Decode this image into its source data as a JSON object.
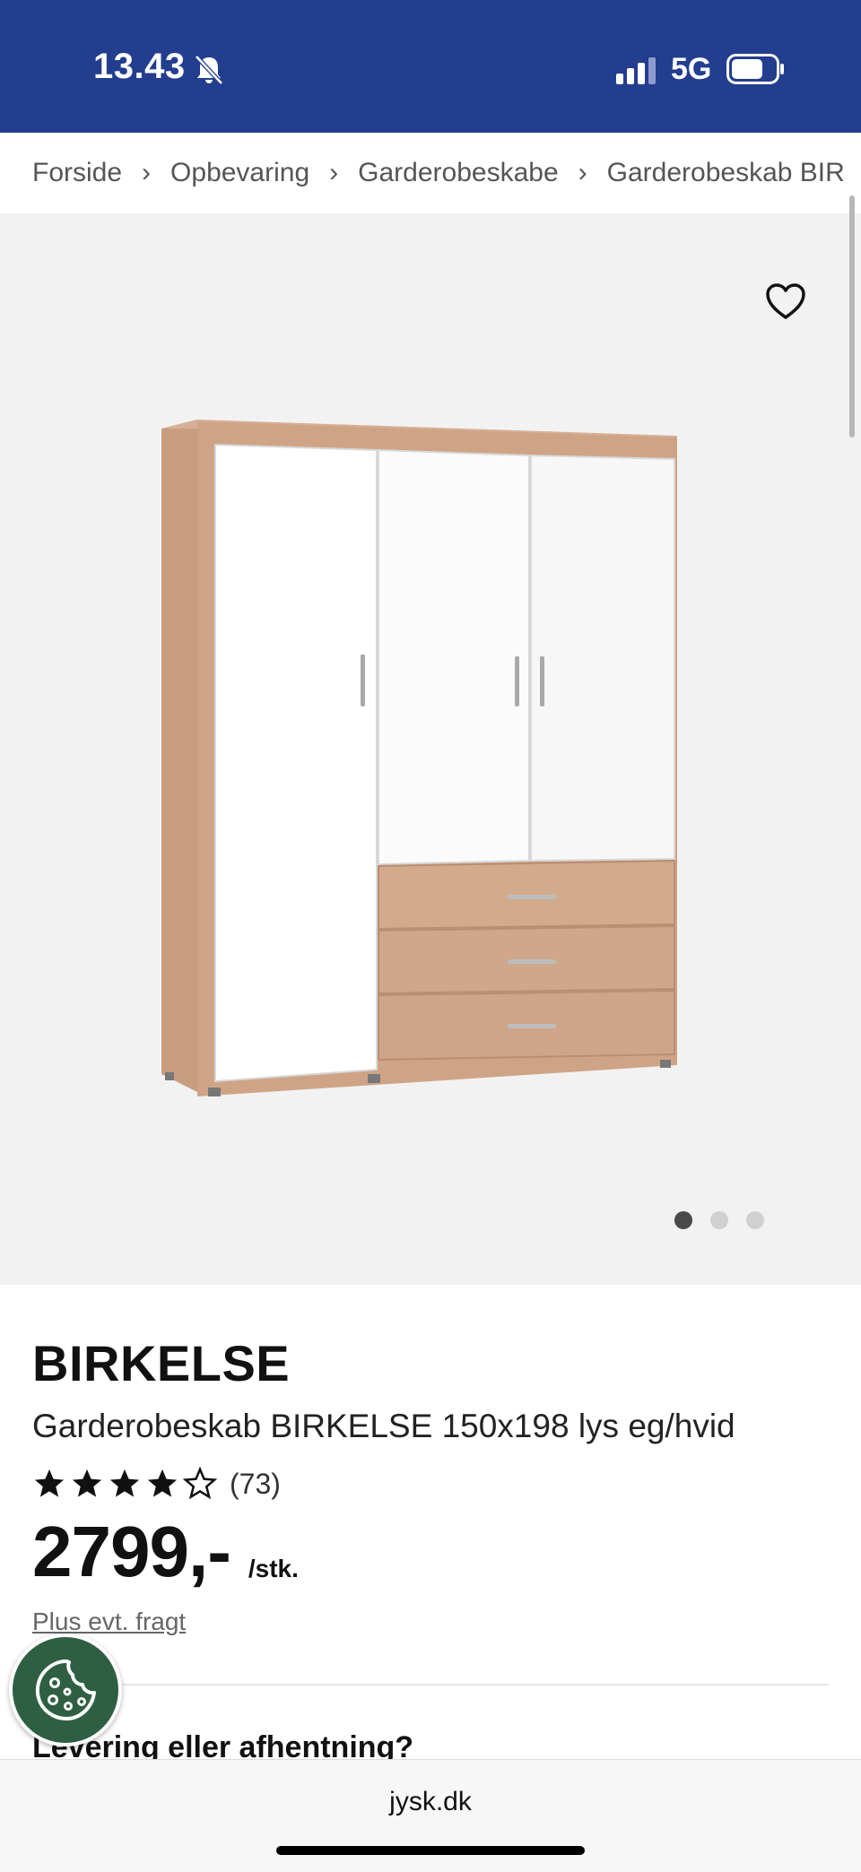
{
  "status_bar": {
    "time": "13.43",
    "network": "5G"
  },
  "breadcrumb": [
    {
      "label": "Forside"
    },
    {
      "label": "Opbevaring"
    },
    {
      "label": "Garderobeskabe"
    },
    {
      "label": "Garderobeskab BIR"
    }
  ],
  "gallery": {
    "slide_count": 3,
    "active_slide": 1
  },
  "product": {
    "brand": "BIRKELSE",
    "title": "Garderobeskab BIRKELSE 150x198 lys eg/hvid",
    "rating_stars": 4,
    "rating_max": 5,
    "review_count": "(73)",
    "price": "2799,-",
    "unit": "/stk.",
    "shipping_note": "Plus evt. fragt",
    "delivery_heading": "Levering eller afhentning?"
  },
  "browser": {
    "url": "jysk.dk"
  },
  "colors": {
    "header": "#233d8f",
    "gallery_bg": "#f3f2f3",
    "cookie_button": "#2f5f42"
  }
}
